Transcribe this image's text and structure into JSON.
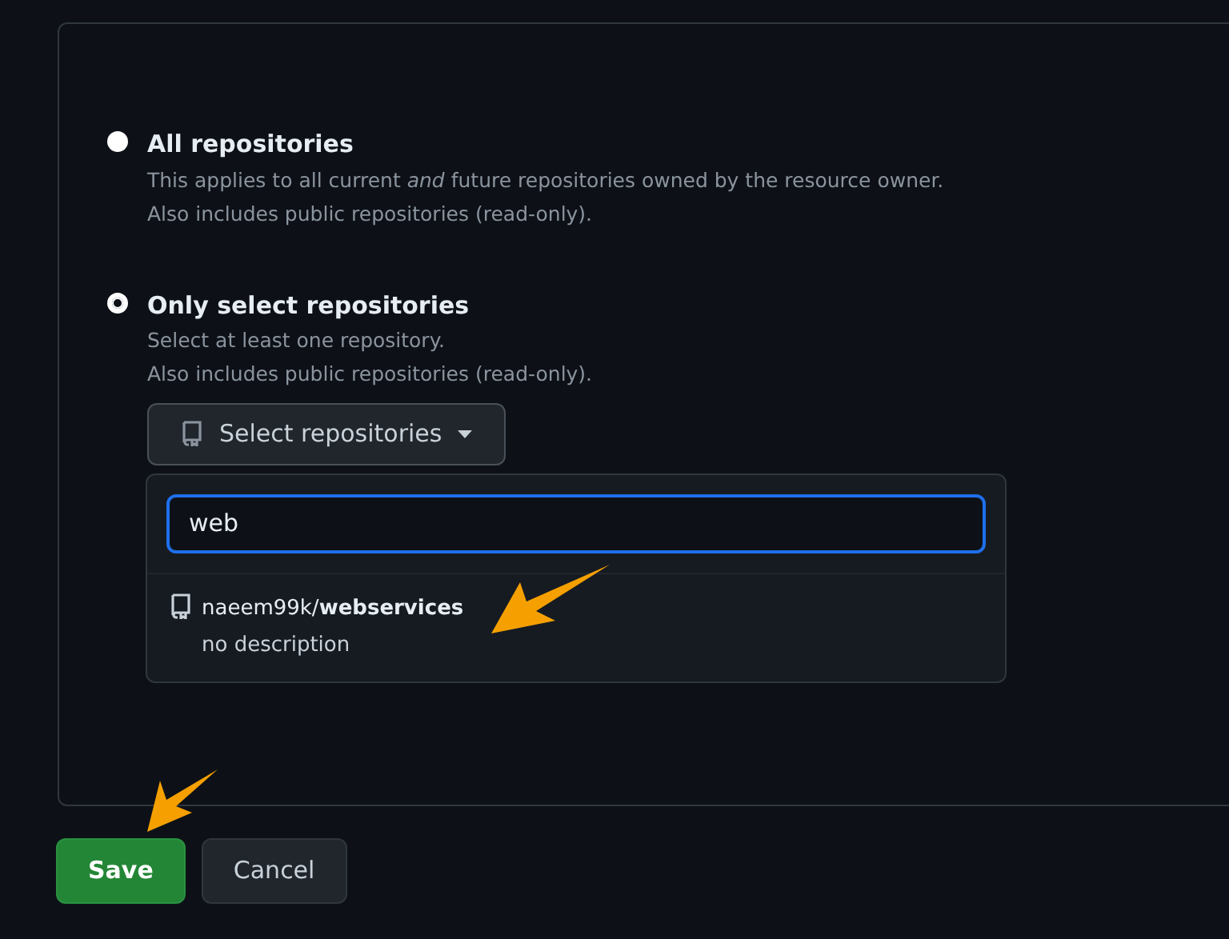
{
  "options": [
    {
      "label": "All repositories",
      "selected": false,
      "description": [
        "This applies to all current *and* future repositories owned by the resource owner.",
        "Also includes public repositories (read-only)."
      ]
    },
    {
      "label": "Only select repositories",
      "selected": true,
      "description": [
        "Select at least one repository.",
        "Also includes public repositories (read-only)."
      ]
    }
  ],
  "select_button": {
    "label": "Select repositories"
  },
  "dropdown": {
    "search_value": "web",
    "results": [
      {
        "name": "naeem99k/**webservices**",
        "description": "no description"
      }
    ]
  },
  "buttons": [
    {
      "label": "Save",
      "kind": "primary"
    },
    {
      "label": "Cancel",
      "kind": "secondary"
    }
  ]
}
